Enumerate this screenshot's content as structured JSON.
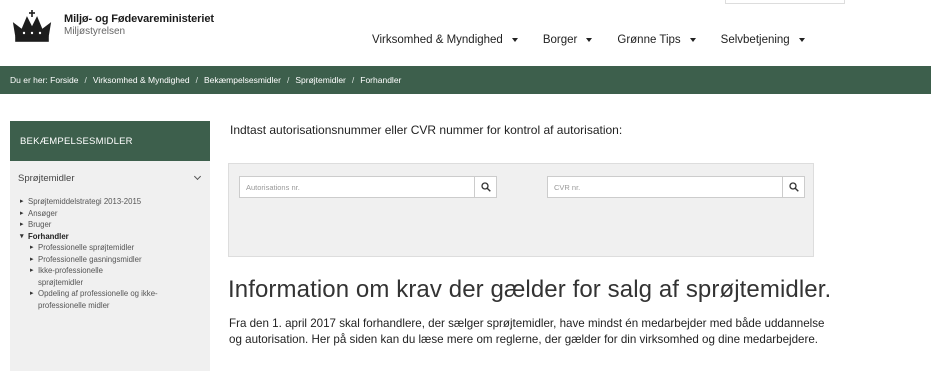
{
  "header": {
    "logo_title": "Miljø- og Fødevareministeriet",
    "logo_subtitle": "Miljøstyrelsen",
    "logo_icon": "crown-icon"
  },
  "nav": {
    "items": [
      {
        "label": "Virksomhed & Myndighed"
      },
      {
        "label": "Borger"
      },
      {
        "label": "Grønne Tips"
      },
      {
        "label": "Selvbetjening"
      }
    ]
  },
  "breadcrumb": {
    "prefix": "Du er her:",
    "items": [
      "Forside",
      "Virksomhed & Myndighed",
      "Bekæmpelsesmidler",
      "Sprøjtemidler",
      "Forhandler"
    ],
    "separator": "/"
  },
  "sidebar": {
    "heading": "BEKÆMPELSESMIDLER",
    "section": "Sprøjtemidler",
    "items": [
      {
        "label": "Sprøjtemiddelstrategi 2013-2015"
      },
      {
        "label": "Ansøger"
      },
      {
        "label": "Bruger"
      },
      {
        "label": "Forhandler"
      }
    ],
    "subitems": [
      {
        "label": "Professionelle sprøjtemidler"
      },
      {
        "label": "Professionelle gasningsmidler"
      },
      {
        "label": "Ikke-professionelle sprøjtemidler"
      },
      {
        "label": "Opdeling af professionelle og ikke-professionelle midler"
      }
    ]
  },
  "main": {
    "intro": "Indtast autorisationsnummer eller CVR nummer for kontrol af autorisation:",
    "search_auth_placeholder": "Autorisations nr.",
    "search_cvr_placeholder": "CVR nr.",
    "info_title": "Information om krav der gælder for salg af sprøjtemidler.",
    "info_paragraph": "Fra den 1. april 2017 skal forhandlere, der sælger sprøjtemidler, have mindst én medarbejder med både uddannelse og autorisation. Her på siden kan du læse mere om reglerne, der gælder for din virksomhed og dine medarbejdere."
  },
  "colors": {
    "brand_green": "#3d5f4c",
    "panel_grey": "#f0f0f0"
  }
}
